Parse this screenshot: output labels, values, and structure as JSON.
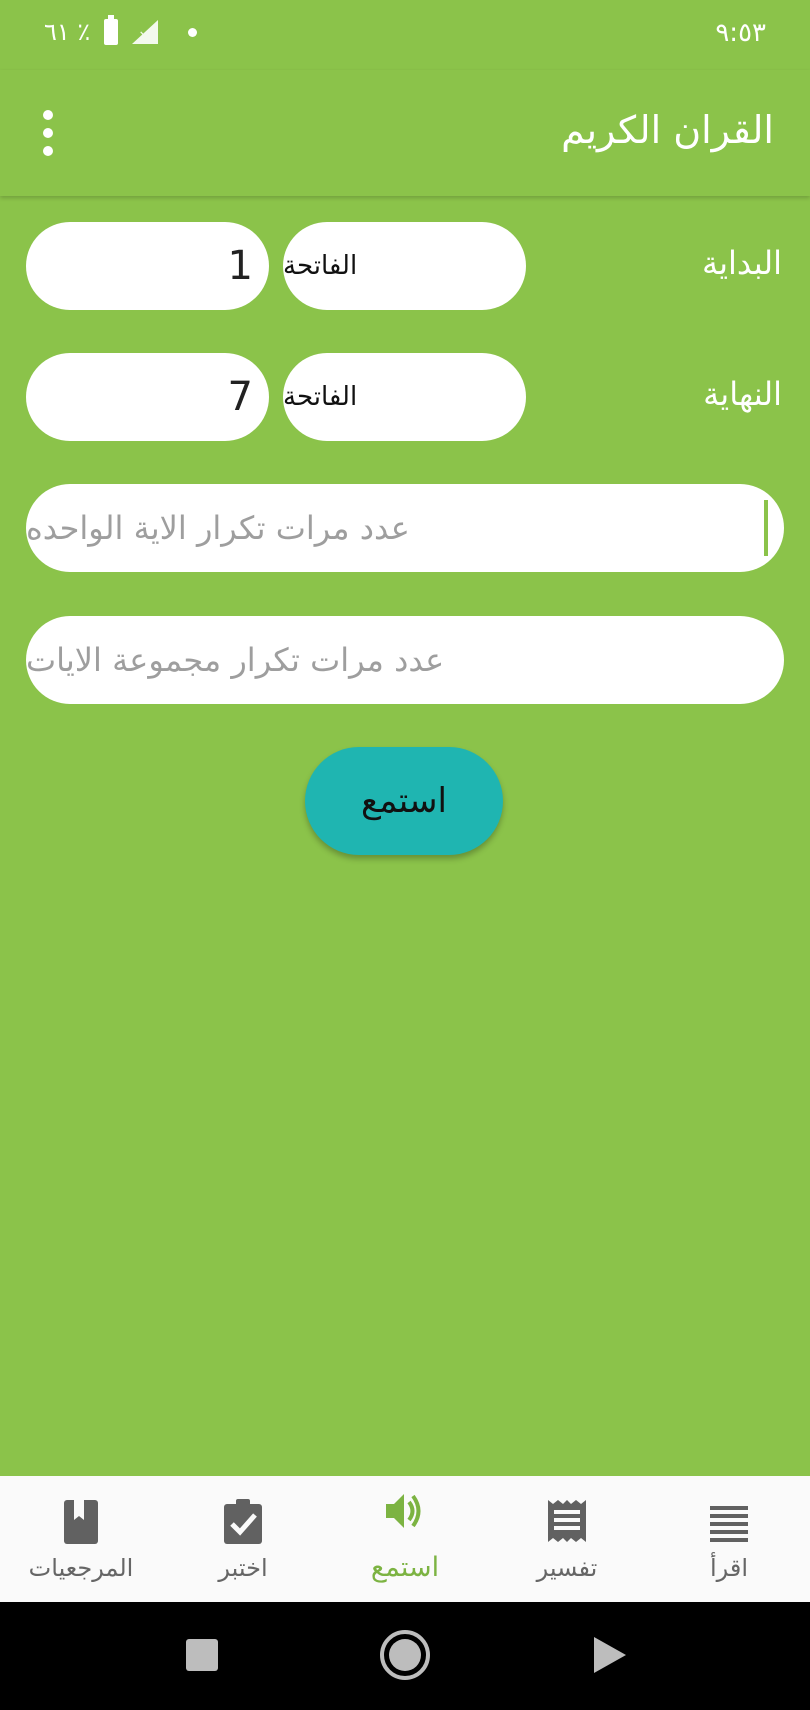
{
  "status_bar": {
    "time": "٩:٥٣",
    "battery": "٦١ ٪"
  },
  "app_bar": {
    "title": "القران الكريم",
    "menu_icon": "more-vert-icon"
  },
  "form": {
    "start": {
      "label": "البداية",
      "surah": "الفاتحة",
      "ayah": "1"
    },
    "end": {
      "label": "النهاية",
      "surah": "الفاتحة",
      "ayah": "7"
    },
    "single_repeat": {
      "placeholder": "عدد مرات تكرار الاية الواحده"
    },
    "group_repeat": {
      "placeholder": "عدد مرات تكرار مجموعة الايات"
    },
    "listen_button": "استمع"
  },
  "bottom_nav": {
    "items": [
      {
        "label": "اقرأ",
        "icon": "list-icon"
      },
      {
        "label": "تفسير",
        "icon": "receipt-icon"
      },
      {
        "label": "استمع",
        "icon": "volume-icon",
        "active": true
      },
      {
        "label": "اختبر",
        "icon": "clipboard-check-icon"
      },
      {
        "label": "المرجعيات",
        "icon": "book-icon"
      }
    ]
  },
  "colors": {
    "primary": "#8bc34a",
    "accent": "#1fb5b1",
    "active_nav": "#7cb342"
  }
}
